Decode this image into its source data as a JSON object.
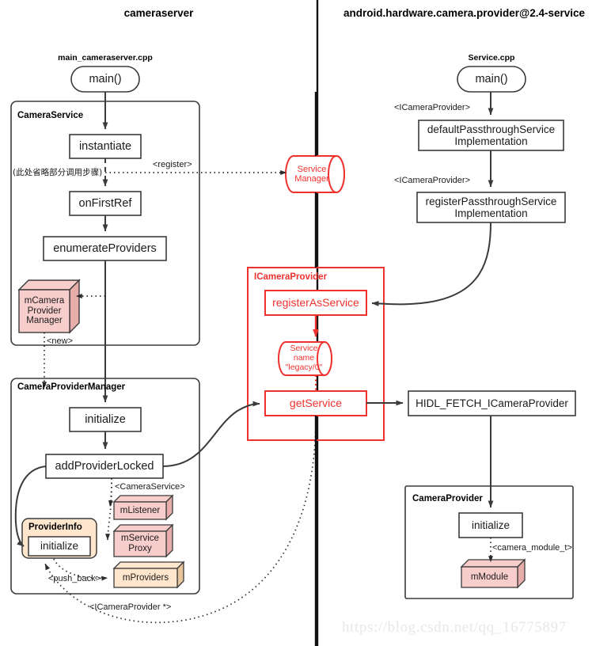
{
  "lanes": [
    {
      "id": "cameraserver",
      "title": "cameraserver"
    },
    {
      "id": "provider-service",
      "title": "android.hardware.camera.provider@2.4-service"
    }
  ],
  "file_labels": {
    "left": "main_cameraserver.cpp",
    "right": "Service.cpp"
  },
  "groups": {
    "camera_service": "CameraService",
    "camera_provider_manager": "CameraProviderManager",
    "icamera_provider": "ICameraProvider",
    "camera_provider": "CameraProvider"
  },
  "nodes": {
    "main_left": "main()",
    "instantiate": "instantiate",
    "on_first_ref": "onFirstRef",
    "enumerate_providers": "enumerateProviders",
    "m_camera_provider_manager": "mCamera\nProvider\nManager",
    "cpm_initialize": "initialize",
    "add_provider_locked": "addProviderLocked",
    "m_listener": "mListener",
    "m_service_proxy": "mService\nProxy",
    "m_providers": "mProviders",
    "provider_info_title": "ProviderInfo",
    "provider_info_initialize": "initialize",
    "service_manager": "Service\nManager",
    "register_as_service": "registerAsService",
    "service_name": "Service\nname\n\"legacy/0\"",
    "get_service": "getService",
    "main_right": "main()",
    "default_passthrough": "defaultPassthroughService\nImplementation",
    "register_passthrough": "registerPassthroughService\nImplementation",
    "hidl_fetch": "HIDL_FETCH_ICameraProvider",
    "cp_initialize": "initialize",
    "m_module": "mModule"
  },
  "edge_labels": {
    "register": "<register>",
    "omitted_steps_cn": "(此处省略部分调用步骤)",
    "new": "<new>",
    "camera_service_ref": "<CameraService>",
    "push_back": "<push_back>",
    "icamera_provider_ptr": "<ICameraProvider *>",
    "icamera_provider_1": "<ICameraProvider>",
    "icamera_provider_2": "<ICameraProvider>",
    "camera_module_t": "<camera_module_t>"
  },
  "watermark": "https://blog.csdn.net/qq_16775897",
  "colors": {
    "red_accent": "#F0322E",
    "pink_fill": "#F8CECC",
    "pink_side": "#E0A8A6",
    "orange_fill": "#FFE6CC",
    "orange_side": "#E8C59B",
    "stroke_dark": "#3B3B3B",
    "background": "#FFFFFF"
  }
}
